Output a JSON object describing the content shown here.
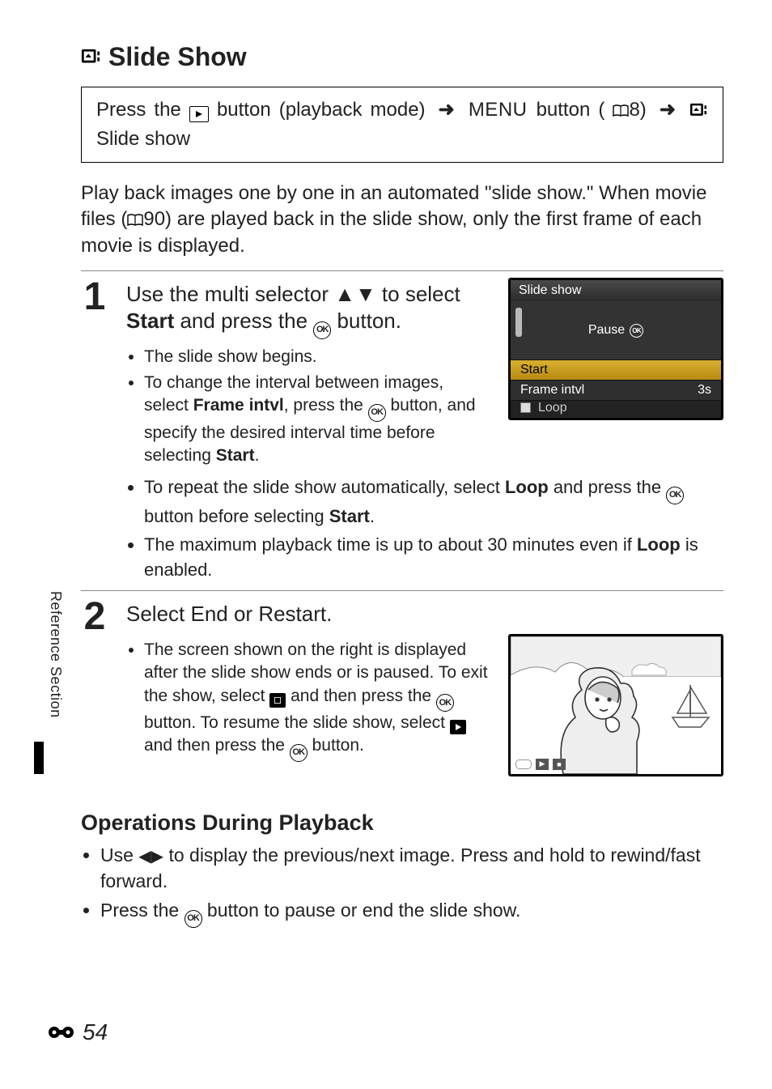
{
  "sideTab": "Reference Section",
  "pageNumber": "54",
  "heading": "Slide Show",
  "navPath": {
    "lead": "Press the ",
    "afterPlay": " button (playback mode)",
    "menuLabel": "MENU",
    "afterMenu1": " button (",
    "menuRef": "8",
    "afterMenu2": ") ",
    "tail": " Slide show"
  },
  "intro": {
    "lead": "Play back images one by one in an automated \"slide show.\" When movie files (",
    "ref": "90",
    "tail": ") are played back in the slide show, only the first frame of each movie is displayed."
  },
  "step1": {
    "num": "1",
    "titleLead": "Use the multi selector ",
    "titleMid": " to select ",
    "titleStart": "Start",
    "titleEnd": " and press the ",
    "titleTail": " button.",
    "b1": "The slide show begins.",
    "b2a": "To change the interval between images, select ",
    "b2b": "Frame intvl",
    "b2c": ", press the ",
    "b2d": " button, and specify the desired interval time before selecting ",
    "b2e": "Start",
    "b2f": ".",
    "b3a": "To repeat the slide show automatically, select ",
    "b3b": "Loop",
    "b3c": " and press the ",
    "b3d": " button before selecting ",
    "b3e": "Start",
    "b3f": ".",
    "b4a": "The maximum playback time is up to about 30 minutes even if ",
    "b4b": "Loop",
    "b4c": " is enabled."
  },
  "menuShot": {
    "title": "Slide show",
    "pause": "Pause",
    "rowStart": "Start",
    "rowFrame": "Frame intvl",
    "rowFrameVal": "3s",
    "rowLoop": "Loop"
  },
  "step2": {
    "num": "2",
    "title": "Select End or Restart.",
    "b1a": "The screen shown on the right is displayed after the slide show ends or is paused. To exit the show, select ",
    "b1b": " and then press the ",
    "b1c": " button. To resume the slide show, select ",
    "b1d": " and then press the ",
    "b1e": " button."
  },
  "opsHeading": "Operations During Playback",
  "ops": {
    "b1a": "Use ",
    "b1b": " to display the previous/next image. Press and hold to rewind/fast forward.",
    "b2a": "Press the ",
    "b2b": " button to pause or end the slide show."
  }
}
